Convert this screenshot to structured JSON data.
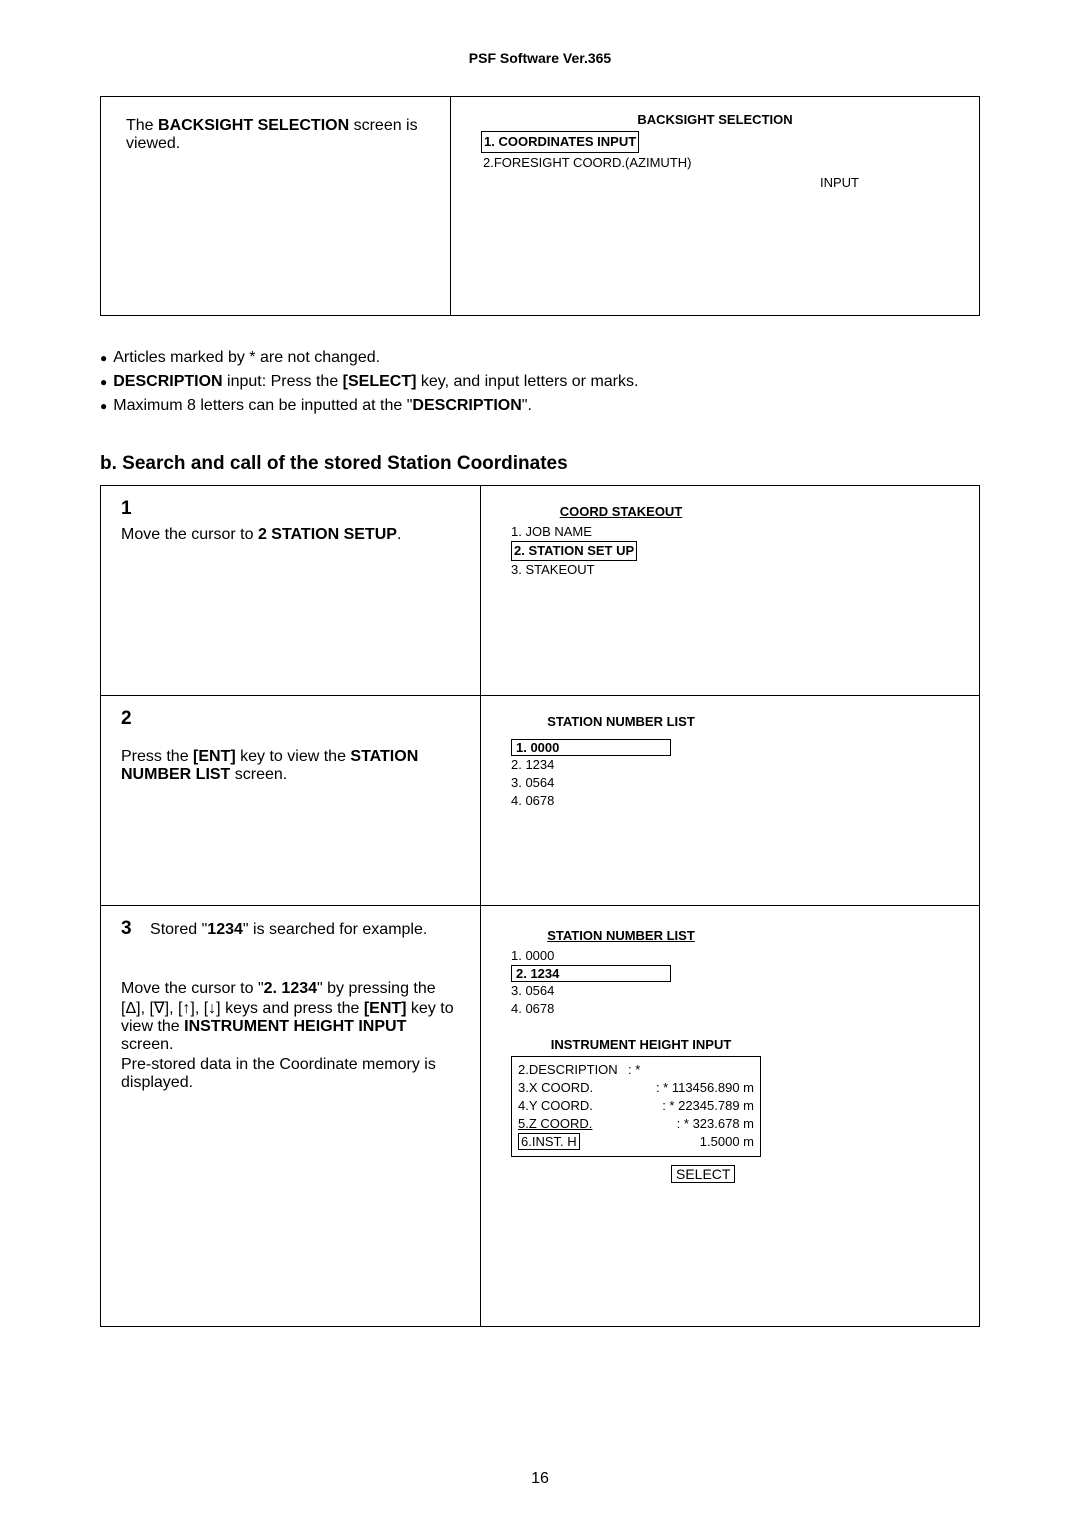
{
  "header": "PSF Software Ver.365",
  "topBox": {
    "leftText1": "The ",
    "leftBold": "BACKSIGHT SELECTION",
    "leftText2": " screen is viewed.",
    "screenTitle": "BACKSIGHT SELECTION",
    "opt1": "1. COORDINATES INPUT",
    "opt2": "2.FORESIGHT COORD.(AZIMUTH)",
    "opt3": "INPUT"
  },
  "bullets": {
    "b1": "Articles marked by * are not changed.",
    "b2a": "DESCRIPTION",
    "b2b": " input: Press the ",
    "b2c": "[SELECT]",
    "b2d": " key, and input letters or marks.",
    "b3a": "Maximum 8 letters can be inputted at the \"",
    "b3b": "DESCRIPTION",
    "b3c": "\"."
  },
  "sectionHeading": "b. Search and call of the stored Station Coordinates",
  "step1": {
    "num": "1",
    "txt1": "Move the cursor to ",
    "bold1": "2 STATION SETUP",
    "txt2": ".",
    "screenTitle": "COORD STAKEOUT",
    "line1": "1. JOB NAME",
    "line2": "2. STATION SET UP",
    "line3": "3. STAKEOUT"
  },
  "step2": {
    "num": "2",
    "txt1": "Press the ",
    "bold1": "[ENT]",
    "txt2": " key to view the ",
    "bold2": "STATION NUMBER LIST",
    "txt3": " screen.",
    "screenTitle": "STATION NUMBER LIST",
    "line1": "1. 0000",
    "line2": "2. 1234",
    "line3": "3. 0564",
    "line4": "4. 0678"
  },
  "step3": {
    "num": "3",
    "firstLine1": "Stored \"",
    "firstBold": "1234",
    "firstLine2": "\" is searched for example.",
    "p1": "Move the cursor to \"",
    "p1b": "2. 1234",
    "p1c": "\" by pressing the [Δ], [∇], [↑], [↓] keys and press the ",
    "p1d": "[ENT]",
    "p1e": " key to view the ",
    "p1f": "INSTRUMENT HEIGHT INPUT",
    "p1g": " screen.",
    "p2": "Pre-stored data in the Coordinate memory is displayed.",
    "listTitle": "STATION NUMBER LIST",
    "l1": "1. 0000",
    "l2": "2. 1234",
    "l3": "3. 0564",
    "l4": "4. 0678",
    "instTitle": "INSTRUMENT HEIGHT INPUT",
    "r1l": "2.DESCRIPTION",
    "r1v": ": *",
    "r2l": "3.X COORD.",
    "r2v": ": * 113456.890 m",
    "r3l": "4.Y COORD.",
    "r3v": ": *   22345.789 m",
    "r4l": "5.Z COORD.",
    "r4v": ": *       323.678 m",
    "r5l": "6.INST. H",
    "r5v": "1.5000 m",
    "select": "SELECT"
  },
  "pageNum": "16"
}
